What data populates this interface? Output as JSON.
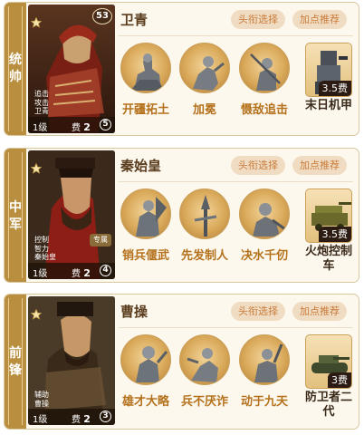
{
  "cards": [
    {
      "position": "统帅",
      "hero_name": "卫青",
      "traits": [
        "追击",
        "攻击",
        "卫青"
      ],
      "level": "1级",
      "cost_label": "费",
      "cost_value": "2",
      "extra_value": "5",
      "badge": "53",
      "specialty": "",
      "buttons": [
        "头衔选择",
        "加点推荐"
      ],
      "skills": [
        {
          "name": "开疆拓土",
          "icon": "rider-statue-icon"
        },
        {
          "name": "加冕",
          "icon": "warrior-crouch-icon"
        },
        {
          "name": "慑敌追击",
          "icon": "warrior-spear-icon"
        }
      ],
      "item": {
        "name": "末日机甲",
        "cost": "3.5费",
        "icon": "mech-icon"
      }
    },
    {
      "position": "中军",
      "hero_name": "秦始皇",
      "traits": [
        "控制",
        "智力",
        "秦始皇"
      ],
      "level": "1级",
      "cost_label": "费",
      "cost_value": "2",
      "extra_value": "4",
      "badge": "",
      "specialty": "专属",
      "buttons": [
        "头衔选择",
        "加点推荐"
      ],
      "skills": [
        {
          "name": "销兵偃武",
          "icon": "general-banner-icon"
        },
        {
          "name": "先发制人",
          "icon": "spear-icon"
        },
        {
          "name": "决水千仞",
          "icon": "warrior-kneel-icon"
        }
      ],
      "item": {
        "name": "火炮控制车",
        "cost": "3.5费",
        "icon": "cannon-cart-icon"
      }
    },
    {
      "position": "前锋",
      "hero_name": "曹操",
      "traits": [
        "辅助",
        "曹操"
      ],
      "level": "1级",
      "cost_label": "费",
      "cost_value": "2",
      "extra_value": "3",
      "badge": "",
      "specialty": "",
      "buttons": [
        "头衔选择",
        "加点推荐"
      ],
      "skills": [
        {
          "name": "雄才大略",
          "icon": "commander-icon"
        },
        {
          "name": "兵不厌诈",
          "icon": "warrior-run-icon"
        },
        {
          "name": "动于九天",
          "icon": "warrior-raise-icon"
        }
      ],
      "item": {
        "name": "防卫者二代",
        "cost": "3费",
        "icon": "tank-icon"
      }
    }
  ],
  "colors": {
    "strip": "#b98f3f",
    "card_bg": "#fdf8ee",
    "skill_text": "#b4711c",
    "tag_bg": "#f0dcc2",
    "tag_text": "#c87b3a"
  }
}
